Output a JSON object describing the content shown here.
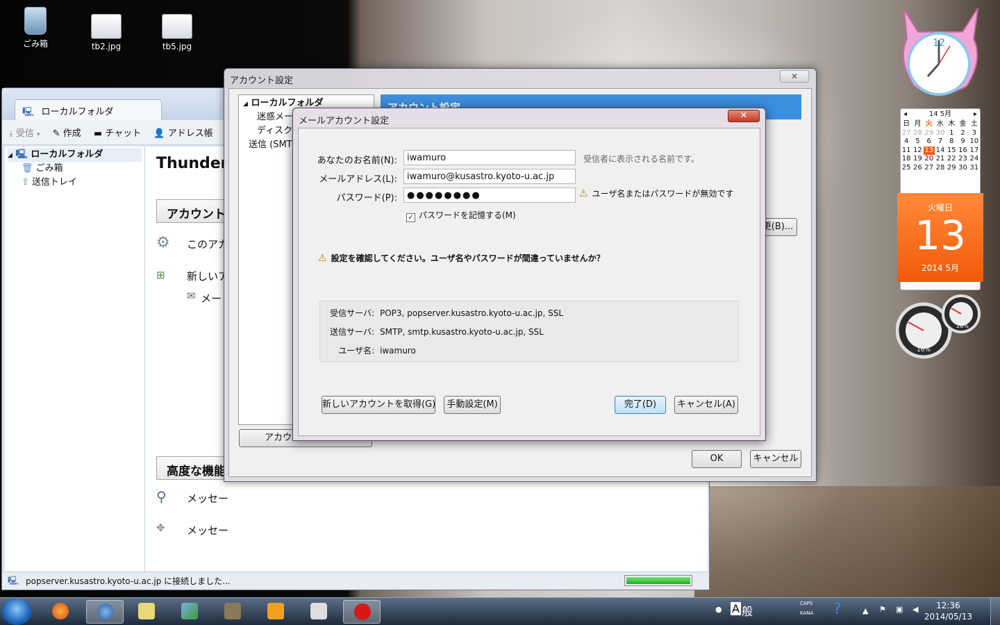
{
  "desktop": {
    "icons": [
      {
        "label": "ごみ箱"
      },
      {
        "label": "tb2.jpg"
      },
      {
        "label": "tb5.jpg"
      }
    ]
  },
  "thunderbird": {
    "tab_label": "ローカルフォルダ",
    "toolbar": {
      "receive": "受信",
      "compose": "作成",
      "chat": "チャット",
      "addressbook": "アドレス帳"
    },
    "folders": [
      "ローカルフォルダ",
      "ごみ箱",
      "送信トレイ"
    ],
    "content": {
      "heading": "Thunder",
      "section1": "アカウント",
      "line1": "このアカ",
      "line2": "新しいア",
      "line3": "メー",
      "section2": "高度な機能",
      "line4": "メッセー",
      "line5": "メッセー"
    },
    "status_text": "popserver.kusastro.kyoto-u.ac.jp に接続しました...",
    "progress": 1.0
  },
  "account_settings": {
    "title": "アカウント設定",
    "close": "✕",
    "tree": [
      "ローカルフォルダ",
      "迷惑メール",
      "ディスク領域",
      "送信 (SMTP)"
    ],
    "banner": "アカウント設定",
    "partial_button": "更(B)...",
    "actions_button": "アカウント",
    "ok": "OK",
    "cancel": "キャンセル"
  },
  "mail_dialog": {
    "title": "メールアカウント設定",
    "close": "✕",
    "name_label": "あなたのお名前(N):",
    "name_value": "iwamuro",
    "name_hint": "受信者に表示される名前です。",
    "email_label": "メールアドレス(L):",
    "email_value": "iwamuro@kusastro.kyoto-u.ac.jp",
    "password_label": "パスワード(P):",
    "password_value": "●●●●●●●●",
    "password_warning": "ユーザ名またはパスワードが無効です",
    "remember_label": "パスワードを記憶する(M)",
    "main_warning": "設定を確認してください。ユーザ名やパスワードが間違っていませんか？",
    "incoming_label": "受信サーバ:",
    "incoming_value": "POP3, popserver.kusastro.kyoto-u.ac.jp, SSL",
    "outgoing_label": "送信サーバ:",
    "outgoing_value": "SMTP, smtp.kusastro.kyoto-u.ac.jp, SSL",
    "user_label": "ユーザ名:",
    "user_value": "iwamuro",
    "get_account_button": "新しいアカウントを取得(G)",
    "manual_button": "手動設定(M)",
    "done_button": "完了(D)",
    "cancel_button": "キャンセル(A)"
  },
  "gadgets": {
    "clock_12": "12",
    "calendar": {
      "month_label": "14 5月",
      "weekdays": [
        "日",
        "月",
        "火",
        "水",
        "木",
        "金",
        "土"
      ],
      "weeks": [
        [
          "27",
          "28",
          "29",
          "30",
          "1",
          "2",
          "3"
        ],
        [
          "4",
          "5",
          "6",
          "7",
          "8",
          "9",
          "10"
        ],
        [
          "11",
          "12",
          "13",
          "14",
          "15",
          "16",
          "17"
        ],
        [
          "18",
          "19",
          "20",
          "21",
          "22",
          "23",
          "24"
        ],
        [
          "25",
          "26",
          "27",
          "28",
          "29",
          "30",
          "31"
        ]
      ],
      "weekday_name": "火曜日",
      "day_number": "13",
      "year_month": "2014 5月"
    },
    "meter_cpu": "16%",
    "meter_mem": "28%"
  },
  "taskbar": {
    "ime_mode": "A",
    "ime_kanji": "般",
    "caps": "CAPS",
    "kana": "KANA",
    "time": "12:36",
    "date": "2014/05/13"
  },
  "colors": {
    "banner": "#3d8fe0",
    "calendar_orange": "#f05a0a",
    "mail_close": "#c23b22"
  }
}
